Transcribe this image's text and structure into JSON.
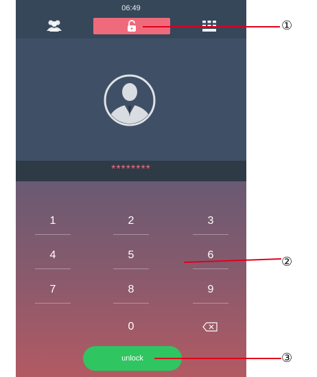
{
  "status": {
    "time": "06:49"
  },
  "tabs": [
    {
      "icon": "contacts-icon"
    },
    {
      "icon": "unlock-icon",
      "active": true
    },
    {
      "icon": "keypad-icon"
    }
  ],
  "password": {
    "masked": "********"
  },
  "keypad": {
    "keys": [
      "1",
      "2",
      "3",
      "4",
      "5",
      "6",
      "7",
      "8",
      "9",
      "0"
    ],
    "delete_icon": "backspace-icon"
  },
  "unlock_button": {
    "label": "unlock"
  },
  "callouts": [
    "①",
    "②",
    "③"
  ],
  "colors": {
    "tab_active": "#ef6b7b",
    "password_text": "#f26d7d",
    "unlock_button": "#2fc560",
    "callout_line": "#e0001b"
  }
}
